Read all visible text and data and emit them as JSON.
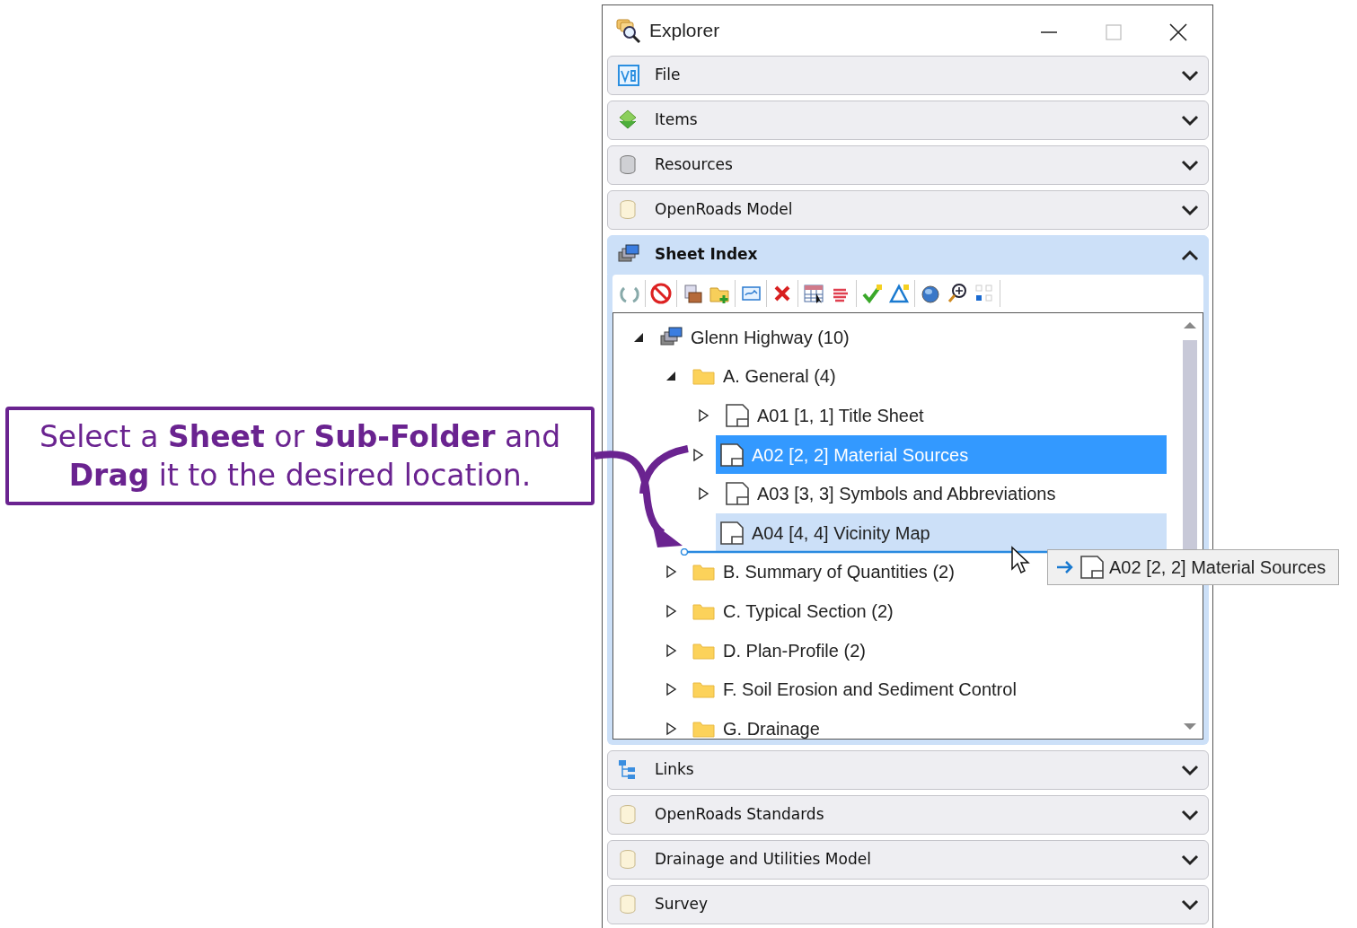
{
  "callout": {
    "text": "Select a **Sheet** or **Sub-Folder** and **Drag** it to the desired location."
  },
  "window": {
    "title": "Explorer"
  },
  "sections": [
    {
      "label": "File",
      "expanded": false
    },
    {
      "label": "Items",
      "expanded": false
    },
    {
      "label": "Resources",
      "expanded": false
    },
    {
      "label": "OpenRoads Model",
      "expanded": false
    },
    {
      "label": "Sheet Index",
      "expanded": true,
      "tree": [
        {
          "label": "Glenn Highway (10)",
          "kind": "root",
          "expandable": true,
          "expanded": true,
          "selected": false,
          "hovered": false,
          "children": [
            {
              "label": "A. General (4)",
              "kind": "folder",
              "expandable": true,
              "expanded": true,
              "selected": false,
              "hovered": false,
              "children": [
                {
                  "label": "A01 [1, 1] Title Sheet",
                  "kind": "sheet",
                  "expandable": true,
                  "expanded": false,
                  "selected": false,
                  "hovered": false
                },
                {
                  "label": "A02 [2, 2] Material Sources",
                  "kind": "sheet",
                  "expandable": true,
                  "expanded": false,
                  "selected": true,
                  "hovered": false
                },
                {
                  "label": "A03 [3, 3] Symbols and Abbreviations",
                  "kind": "sheet",
                  "expandable": true,
                  "expanded": false,
                  "selected": false,
                  "hovered": false
                },
                {
                  "label": "A04 [4, 4] Vicinity Map",
                  "kind": "sheet",
                  "expandable": false,
                  "selected": false,
                  "hovered": true
                }
              ]
            },
            {
              "label": "B. Summary of Quantities (2)",
              "kind": "folder",
              "expandable": true,
              "expanded": false,
              "selected": false,
              "hovered": false
            },
            {
              "label": "C. Typical Section (2)",
              "kind": "folder",
              "expandable": true,
              "expanded": false,
              "selected": false,
              "hovered": false
            },
            {
              "label": "D. Plan-Profile (2)",
              "kind": "folder",
              "expandable": true,
              "expanded": false,
              "selected": false,
              "hovered": false
            },
            {
              "label": "F. Soil Erosion and Sediment Control",
              "kind": "folder",
              "expandable": true,
              "expanded": false,
              "selected": false,
              "hovered": false
            },
            {
              "label": "G. Drainage",
              "kind": "folder",
              "expandable": true,
              "expanded": false,
              "selected": false,
              "hovered": false
            }
          ]
        }
      ]
    },
    {
      "label": "Links",
      "expanded": false
    },
    {
      "label": "OpenRoads Standards",
      "expanded": false
    },
    {
      "label": "Drainage and Utilities Model",
      "expanded": false
    },
    {
      "label": "Survey",
      "expanded": false
    }
  ],
  "drag_preview": {
    "label": "A02 [2, 2] Material Sources"
  }
}
